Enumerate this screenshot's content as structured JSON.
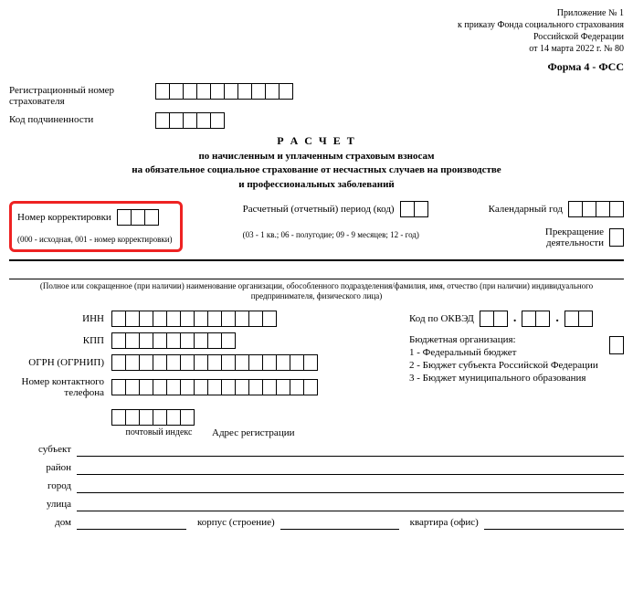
{
  "header": {
    "appendix": "Приложение № 1",
    "order_line1": "к приказу Фонда социального страхования",
    "order_line2": "Российской Федерации",
    "order_line3": "от 14 марта 2022 г. № 80",
    "form_code": "Форма 4 - ФСС"
  },
  "reg": {
    "reg_number_label": "Регистрационный номер страхователя",
    "sub_code_label": "Код подчиненности"
  },
  "title": {
    "main": "Р А С Ч Е Т",
    "line1": "по начисленным и уплаченным страховым взносам",
    "line2": "на обязательное социальное страхование от несчастных случаев на производстве",
    "line3": "и профессиональных заболеваний"
  },
  "correction": {
    "label": "Номер корректировки",
    "hint": "(000 - исходная, 001 - номер корректировки)"
  },
  "period": {
    "label": "Расчетный (отчетный) период  (код)",
    "hint": "(03 - 1 кв.; 06 - полугодие; 09 - 9 месяцев; 12 - год)"
  },
  "year": {
    "label": "Календарный год"
  },
  "termination": {
    "label_l1": "Прекращение",
    "label_l2": "деятельности"
  },
  "org_note": "(Полное или сокращенное (при наличии) наименование организации, обособленного подразделения/фамилия, имя, отчество (при наличии) индивидуального предпринимателя, физического лица)",
  "ids": {
    "inn": "ИНН",
    "kpp": "КПП",
    "ogrn": "ОГРН (ОГРНИП)",
    "phone_l1": "Номер контактного",
    "phone_l2": "телефона"
  },
  "okved_label": "Код по ОКВЭД",
  "budget": {
    "title": "Бюджетная организация:",
    "b1": "1 - Федеральный бюджет",
    "b2": "2 - Бюджет субъекта Российской Федерации",
    "b3": "3 - Бюджет муниципального образования"
  },
  "address": {
    "post_index": "почтовый индекс",
    "addr_reg": "Адрес регистрации",
    "subject": "субъект",
    "district": "район",
    "city": "город",
    "street": "улица",
    "house": "дом",
    "building": "корпус (строение)",
    "apartment": "квартира (офис)"
  }
}
